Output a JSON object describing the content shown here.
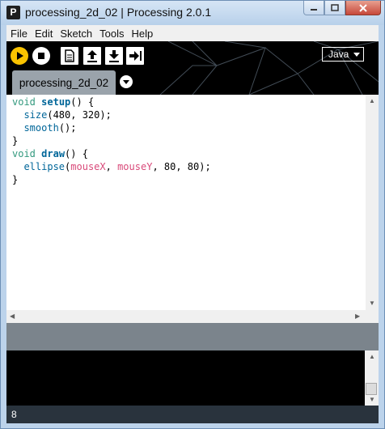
{
  "window": {
    "title": "processing_2d_02 | Processing 2.0.1",
    "app_icon_letter": "P"
  },
  "menu": [
    "File",
    "Edit",
    "Sketch",
    "Tools",
    "Help"
  ],
  "toolbar": {
    "mode": "Java"
  },
  "tab": {
    "label": "processing_2d_02"
  },
  "code": {
    "line1": {
      "kw": "void",
      "fn": "setup",
      "rest": "() {"
    },
    "line2": {
      "fn": "size",
      "args": "(480, 320);"
    },
    "line3": {
      "fn": "smooth",
      "args": "();"
    },
    "line4": "}",
    "line5": {
      "kw": "void",
      "fn": "draw",
      "rest": "() {"
    },
    "line6": {
      "fn": "ellipse",
      "open": "(",
      "var1": "mouseX",
      "sep": ", ",
      "var2": "mouseY",
      "args": ", 80, 80);"
    },
    "line7": "}"
  },
  "status": {
    "line_number": "8"
  },
  "colors": {
    "run_button": "#f9c300",
    "toolbar_bg": "#000000",
    "tab_bg": "#9aa3ab",
    "status_bg": "#29333d"
  }
}
